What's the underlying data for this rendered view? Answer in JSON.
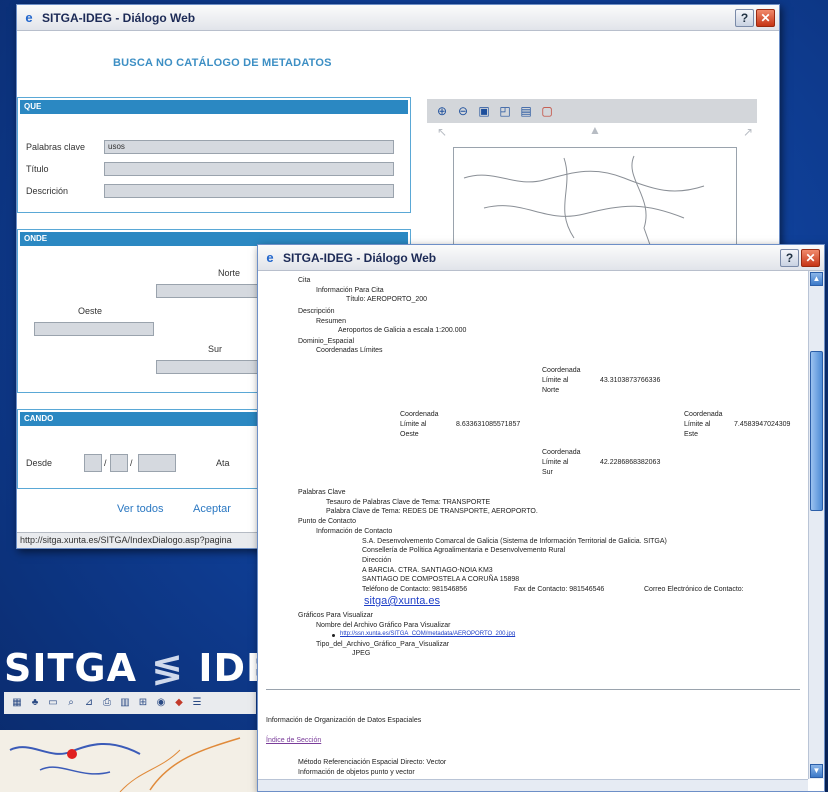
{
  "window1": {
    "title": "SITGA-IDEG - Diálogo Web",
    "heading": "BUSCA NO CATÁLOGO DE METADATOS",
    "que": {
      "header": "QUE",
      "rows": [
        {
          "label": "Palabras clave",
          "value": "usos"
        },
        {
          "label": "Título",
          "value": ""
        },
        {
          "label": "Descrición",
          "value": ""
        }
      ]
    },
    "onde": {
      "header": "ONDE",
      "norte": "Norte",
      "oeste": "Oeste",
      "sur": "Sur"
    },
    "cando": {
      "header": "CANDO",
      "desde": "Desde",
      "ata": "Ata"
    },
    "actions": {
      "ver_todos": "Ver todos",
      "aceptar": "Aceptar"
    },
    "status": "http://sitga.xunta.es/SITGA/IndexDialogo.asp?pagina"
  },
  "brand": {
    "left": "SITGA",
    "sep": "≶",
    "right": "IDE"
  },
  "window2": {
    "title": "SITGA-IDEG - Diálogo Web",
    "lines": {
      "cita": "Cita",
      "info_cita": "Información Para Cita",
      "titulo": "Título: AEROPORTO_200",
      "descripcion": "Descripción",
      "resumen": "Resumen",
      "resumen_val": "Aeroportos de Galicia a escala 1:200.000",
      "dominio": "Dominio_Espacial",
      "coords": "Coordenadas Límites",
      "norte_label": [
        "Coordenada",
        "Límite al",
        "Norte"
      ],
      "norte_val": "43.3103873766336",
      "oeste_label": [
        "Coordenada",
        "Límite al",
        "Oeste"
      ],
      "oeste_val": "8.633631085571857",
      "este_label": [
        "Coordenada",
        "Límite al",
        "Este"
      ],
      "este_val": "7.4583947024309",
      "sur_label": [
        "Coordenada",
        "Límite al",
        "Sur"
      ],
      "sur_val": "42.2286868382063",
      "palabras": "Palabras Clave",
      "tesauro": "Tesauro de Palabras Clave de Tema: TRANSPORTE",
      "palabra_tema": "Palabra Clave de Tema: REDES DE TRANSPORTE, AEROPORTO.",
      "punto": "Punto de Contacto",
      "info_contacto": "Información de Contacto",
      "org": "S.A. Desenvolvemento Comarcal de Galicia (Sistema de Información Territorial de Galicia. SITGA)",
      "conselleria": "Consellería de Política Agroalimentaria e Desenvolvemento Rural",
      "direccion": "Dirección",
      "dir1": "A BARCIA. CTRA. SANTIAGO-NOIA KM3",
      "dir2": "SANTIAGO DE COMPOSTELA A CORUÑA 15898",
      "telefono": "Teléfono de Contacto: 981546856",
      "fax": "Fax de Contacto: 981546546",
      "correo": "Correo Electrónico de Contacto:",
      "email": "sitga@xunta.es",
      "graficos": "Gráficos Para Visualizar",
      "nombre_archivo": "Nombre del Archivo Gráfico Para Visualizar",
      "archivo_link": "http://ssn.xunta.es/SITGA_COM/metadata/AEROPORTO_200.jpg",
      "tipo_archivo": "Tipo_del_Archivo_Gráfico_Para_Visualizar",
      "jpeg": "JPEG",
      "info_org": "Información de Organización de Datos Espaciales",
      "indice": "Índice de Sección",
      "metodo": "Método Referenciación Espacial Directo: Vector",
      "info_objetos": "Información de objetos punto y vector"
    }
  }
}
